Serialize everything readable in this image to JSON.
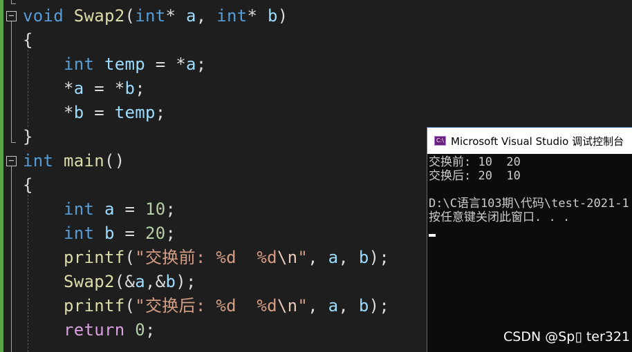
{
  "editor": {
    "lines": {
      "l1": {
        "kw1": "void",
        "fn": "Swap2",
        "p1": "(",
        "kw2": "int",
        "r1": "* ",
        "v1": "a",
        "p2": ", ",
        "kw3": "int",
        "r2": "* ",
        "v2": "b",
        "p3": ")"
      },
      "l2": {
        "brace": "{"
      },
      "l3": {
        "kw": "int",
        "v1": "temp",
        "r1": " = *",
        "v2": "a",
        "p": ";"
      },
      "l4": {
        "r1": "*",
        "v1": "a",
        "r2": " = *",
        "v2": "b",
        "p": ";"
      },
      "l5": {
        "r1": "*",
        "v1": "b",
        "r2": " = ",
        "v2": "temp",
        "p": ";"
      },
      "l6": {
        "brace": "}"
      },
      "l7": {
        "kw": "int",
        "fn": "main",
        "p": "()"
      },
      "l8": {
        "brace": "{"
      },
      "l9": {
        "kw": "int",
        "v": "a",
        "r": " = ",
        "n": "10",
        "p": ";"
      },
      "l10": {
        "kw": "int",
        "v": "b",
        "r": " = ",
        "n": "20",
        "p": ";"
      },
      "l11": {
        "fn": "printf",
        "p1": "(",
        "s1": "\"交换前: %d  %d",
        "esc": "\\n",
        "s2": "\"",
        "c1": ", ",
        "v1": "a",
        "c2": ", ",
        "v2": "b",
        "p2": ");"
      },
      "l12": {
        "fn": "Swap2",
        "p1": "(&",
        "v1": "a",
        "c": ",&",
        "v2": "b",
        "p2": ");"
      },
      "l13": {
        "fn": "printf",
        "p1": "(",
        "s1": "\"交换后: %d  %d",
        "esc": "\\n",
        "s2": "\"",
        "c1": ", ",
        "v1": "a",
        "c2": ", ",
        "v2": "b",
        "p2": ");"
      },
      "l14": {
        "kw": "return",
        "n": "0",
        "p": ";"
      }
    },
    "fold_glyph": "−"
  },
  "console": {
    "icon_text": "C:\\",
    "title": "Microsoft Visual Studio 调试控制台",
    "output": "交换前: 10  20\n交换后: 20  10\n\nD:\\C语言103期\\代码\\test-2021-1\n按任意键关闭此窗口. . ."
  },
  "watermark": "CSDN @Sp▯ ter321"
}
